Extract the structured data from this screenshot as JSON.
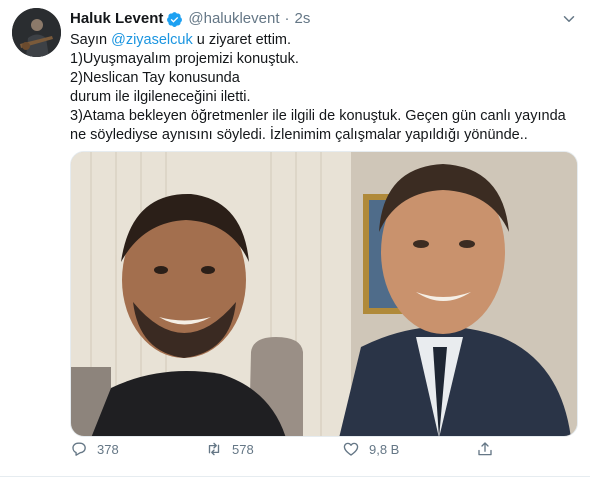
{
  "tweet": {
    "author_name": "Haluk Levent",
    "handle": "@haluklevent",
    "separator": "·",
    "time": "2s",
    "text_prefix": "Sayın ",
    "mention": "@ziyaselcuk",
    "text_suffix": " u ziyaret ettim.",
    "lines": [
      "1)Uyuşmayalım projemizi konuştuk.",
      "2)Neslican Tay konusunda",
      "durum ile ilgileneceğini iletti.",
      "3)Atama bekleyen öğretmenler ile ilgili de konuştuk. Geçen gün canlı yayında",
      "ne söylediyse aynısını söyledi. İzlenimim çalışmalar yapıldığı yönünde.."
    ],
    "counts": {
      "replies": "378",
      "retweets": "578",
      "likes": "9,8 B"
    }
  },
  "colors": {
    "link": "#1b95e0",
    "secondary_text": "#657786",
    "verified": "#1da1f2"
  },
  "icons": {
    "verified": "verified-badge-icon",
    "caret": "chevron-down-icon",
    "reply": "reply-icon",
    "retweet": "retweet-icon",
    "like": "heart-icon",
    "share": "share-icon"
  }
}
